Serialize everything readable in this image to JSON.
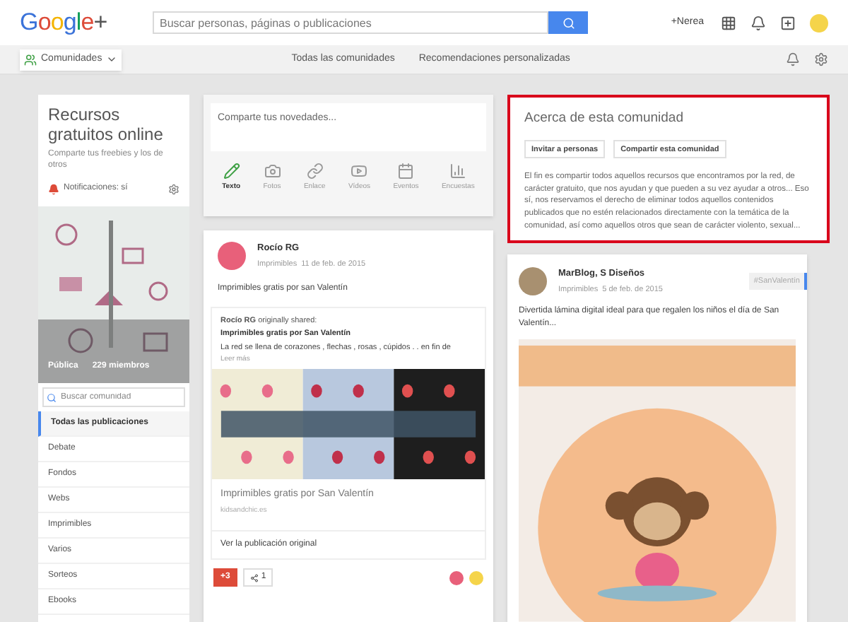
{
  "header": {
    "logo_parts": [
      "G",
      "o",
      "o",
      "g",
      "l",
      "e",
      "+"
    ],
    "search": {
      "placeholder": "Buscar personas, páginas o publicaciones"
    },
    "user": "+Nerea"
  },
  "subnav": {
    "dropdown": "Comunidades",
    "links": [
      "Todas las comunidades",
      "Recomendaciones personalizadas"
    ]
  },
  "community": {
    "title": "Recursos gratuitos online",
    "subtitle": "Comparte tus freebies y los de otros",
    "notifications": "Notificaciones: sí",
    "visibility": "Pública",
    "members": "229 miembros",
    "search": {
      "placeholder": "Buscar comunidad"
    },
    "categories": [
      {
        "label": "Todas las publicaciones",
        "selected": true
      },
      {
        "label": "Debate",
        "selected": false
      },
      {
        "label": "Fondos",
        "selected": false
      },
      {
        "label": "Webs",
        "selected": false
      },
      {
        "label": "Imprimibles",
        "selected": false
      },
      {
        "label": "Varios",
        "selected": false
      },
      {
        "label": "Sorteos",
        "selected": false
      },
      {
        "label": "Ebooks",
        "selected": false
      }
    ]
  },
  "composer": {
    "placeholder": "Comparte tus novedades...",
    "tools": [
      {
        "label": "Texto",
        "selected": true,
        "kind": "pencil"
      },
      {
        "label": "Fotos",
        "selected": false,
        "kind": "camera"
      },
      {
        "label": "Enlace",
        "selected": false,
        "kind": "link"
      },
      {
        "label": "Vídeos",
        "selected": false,
        "kind": "video"
      },
      {
        "label": "Eventos",
        "selected": false,
        "kind": "calendar"
      },
      {
        "label": "Encuestas",
        "selected": false,
        "kind": "chart"
      }
    ]
  },
  "post": {
    "author": "Rocío RG",
    "category": "Imprimibles",
    "date": "11 de feb. de 2015",
    "text": "Imprimibles gratis por san Valentín",
    "shared_line": "**Rocío RG** originally shared:",
    "shared_title": "Imprimibles gratis por San Valentín",
    "shared_text": "La red se llena de corazones , flechas , rosas , cúpidos . . en fin de",
    "read_more": "Leer más",
    "link_title": "Imprimibles gratis por San Valentín",
    "link_domain": "kidsandchic.es",
    "view_original": "Ver la publicación original",
    "plus_count": "+3",
    "share_count": "1"
  },
  "about": {
    "title": "Acerca de esta comunidad",
    "buttons": [
      "Invitar a personas",
      "Compartir esta comunidad"
    ],
    "text": "El fin es compartir todos aquellos recursos que encontramos por la red, de carácter gratuito, que nos ayudan y que pueden a su vez ayudar a otros... Eso sí, nos reservamos el derecho de eliminar todos aquellos contenidos publicados que no estén relacionados directamente con la temática de la comunidad, así como aquellos otros que sean de carácter violento, sexual..."
  },
  "post2": {
    "author": "MarBlog, S Diseños",
    "category": "Imprimibles",
    "date": "5 de feb. de 2015",
    "tag": "#SanValentín",
    "text": "Divertida lámina digital ideal para que regalen los niños el día de San Valentín..."
  }
}
